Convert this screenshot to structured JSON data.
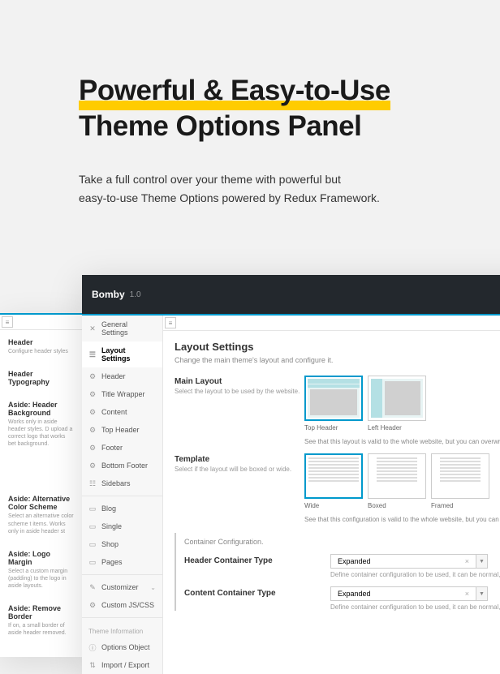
{
  "hero": {
    "line1": "Powerful & Easy-to-Use",
    "line2": "Theme Options Panel",
    "desc_l1": "Take a full control over your theme with powerful but",
    "desc_l2": "easy-to-use Theme Options powered by Redux Framework."
  },
  "topbar": {
    "brand": "Bomby",
    "version": "1.0"
  },
  "sidebar": {
    "items": [
      {
        "label": "General Settings",
        "icon": "✕"
      },
      {
        "label": "Layout Settings",
        "icon": "☰",
        "active": true
      },
      {
        "label": "Header",
        "icon": "⚙"
      },
      {
        "label": "Title Wrapper",
        "icon": "⚙"
      },
      {
        "label": "Content",
        "icon": "⚙"
      },
      {
        "label": "Top Header",
        "icon": "⚙"
      },
      {
        "label": "Footer",
        "icon": "⚙"
      },
      {
        "label": "Bottom Footer",
        "icon": "⚙"
      },
      {
        "label": "Sidebars",
        "icon": "☷"
      }
    ],
    "items2": [
      {
        "label": "Blog",
        "icon": "▭"
      },
      {
        "label": "Single",
        "icon": "▭"
      },
      {
        "label": "Shop",
        "icon": "▭"
      },
      {
        "label": "Pages",
        "icon": "▭"
      }
    ],
    "items3": [
      {
        "label": "Customizer",
        "icon": "✎",
        "chev": true
      },
      {
        "label": "Custom JS/CSS",
        "icon": "⚙"
      }
    ],
    "footer": {
      "info": "Theme Information",
      "options": "Options Object",
      "import": "Import / Export"
    }
  },
  "content": {
    "title": "Layout Settings",
    "subtitle": "Change the main theme's layout and configure it.",
    "main_layout": {
      "label": "Main Layout",
      "hint": "Select the layout to be used by the website.",
      "opt1": "Top Header",
      "opt2": "Left Header",
      "note": "See that this layout is valid to the whole website, but you can overwrite it locally in"
    },
    "template": {
      "label": "Template",
      "hint": "Select if the layout will be boxed or wide.",
      "opt1": "Wide",
      "opt2": "Boxed",
      "opt3": "Framed",
      "note": "See that this configuration is valid to the whole website, but you can overwrite it lo"
    },
    "config": {
      "head": "Container Configuration.",
      "header_type": {
        "label": "Header Container Type",
        "value": "Expanded",
        "hint": "Define container configuration to be used, it can be normal, expanded or compact"
      },
      "content_type": {
        "label": "Content Container Type",
        "value": "Expanded",
        "hint": "Define container configuration to be used, it can be normal, expanded or compact"
      }
    }
  },
  "bg_panel": {
    "h1": {
      "title": "Header",
      "desc": "Configure header styles"
    },
    "h2": {
      "title": "Header Typography"
    },
    "s1": {
      "title": "Aside: Header Background",
      "desc": "Works only in aside header styles. D upload a correct logo that works bet background."
    },
    "s2": {
      "title": "Aside: Alternative Color Scheme",
      "desc": "Select an alternative color scheme t items. Works only in aside header st"
    },
    "s3": {
      "title": "Aside: Logo Margin",
      "desc": "Select a custom margin (padding) to the logo in aside layouts."
    },
    "s4": {
      "title": "Aside: Remove Border",
      "desc": "If on, a small border of aside header removed."
    }
  }
}
